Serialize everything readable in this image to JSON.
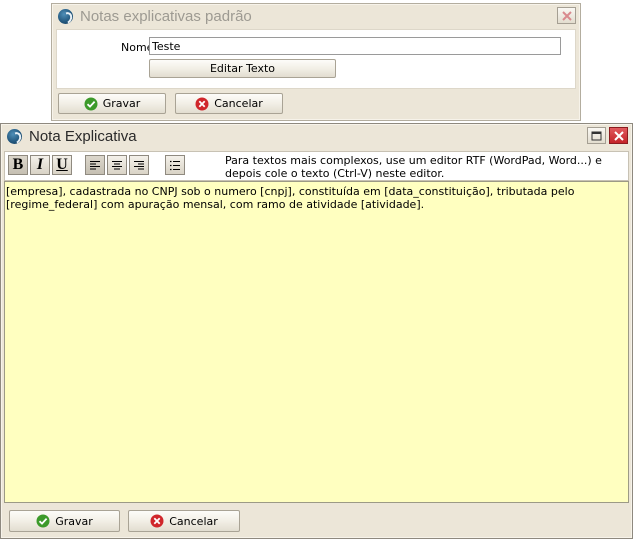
{
  "window1": {
    "title": "Notas explicativas padrão",
    "name_label": "Nome",
    "name_value": "Teste",
    "edit_text_label": "Editar Texto",
    "save_label": "Gravar",
    "cancel_label": "Cancelar"
  },
  "window2": {
    "title": "Nota Explicativa",
    "toolbar": {
      "bold": "B",
      "italic": "I",
      "underline": "U",
      "hint": "Para textos mais complexos, use um editor RTF (WordPad, Word...) e depois cole o texto (Ctrl-V) neste editor."
    },
    "editor_text": "[empresa], cadastrada no CNPJ sob o numero [cnpj], constituída em [data_constituição], tributada pelo [regime_federal] com apuração mensal, com ramo de atividade [atividade].",
    "save_label": "Gravar",
    "cancel_label": "Cancelar"
  },
  "colors": {
    "editor_background": "#ffffc0",
    "window_background": "#ece6d8",
    "close_red": "#c8282d",
    "ok_green": "#3c9a2a"
  },
  "icons": [
    "app-logo-icon",
    "close-icon",
    "maximize-icon",
    "check-icon",
    "cancel-icon",
    "align-left-icon",
    "align-center-icon",
    "align-right-icon",
    "bullet-list-icon"
  ]
}
